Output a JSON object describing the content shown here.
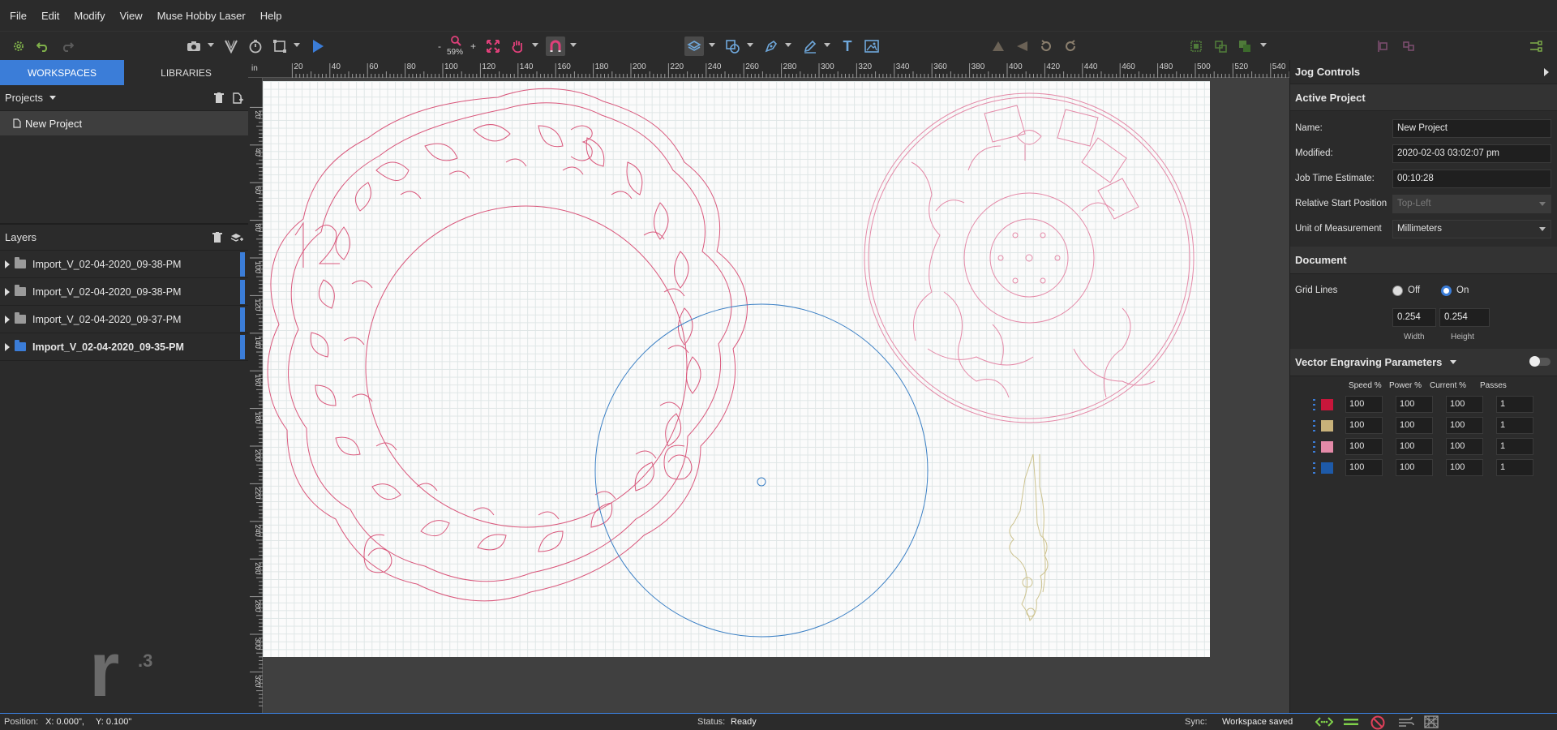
{
  "menu": [
    "File",
    "Edit",
    "Modify",
    "View",
    "Muse Hobby Laser",
    "Help"
  ],
  "toolbar": {
    "zoom_level": "59%",
    "zoom_minus": "-",
    "zoom_plus": "+",
    "text_tool": "T"
  },
  "left_tabs": {
    "workspaces": "WORKSPACES",
    "libraries": "LIBRARIES"
  },
  "projects": {
    "header": "Projects",
    "items": [
      "New Project"
    ]
  },
  "layers": {
    "header": "Layers",
    "items": [
      {
        "name": "Import_V_02-04-2020_09-38-PM",
        "folder_color": "#9a9a9a"
      },
      {
        "name": "Import_V_02-04-2020_09-38-PM",
        "folder_color": "#9a9a9a"
      },
      {
        "name": "Import_V_02-04-2020_09-37-PM",
        "folder_color": "#9a9a9a"
      },
      {
        "name": "Import_V_02-04-2020_09-35-PM",
        "folder_color": "#3b7dd8"
      }
    ]
  },
  "logo": {
    "text": "r",
    "superscript": ".3"
  },
  "ruler": {
    "unit": "in",
    "top_ticks": [
      20,
      40,
      60,
      80,
      100,
      120,
      140,
      160,
      180,
      200,
      220,
      240,
      260,
      280,
      300,
      320,
      340,
      360,
      380,
      400,
      420,
      440,
      460,
      480,
      500,
      520,
      540
    ],
    "left_ticks": [
      20,
      40,
      60,
      80,
      100,
      120,
      140,
      160,
      180,
      200,
      220,
      240,
      260,
      280,
      300,
      320
    ]
  },
  "right_panel": {
    "jog_controls": "Jog Controls",
    "active_project": "Active Project",
    "fields": {
      "name_label": "Name:",
      "name_value": "New Project",
      "modified_label": "Modified:",
      "modified_value": "2020-02-03 03:02:07 pm",
      "job_time_label": "Job Time Estimate:",
      "job_time_value": "00:10:28",
      "start_pos_label": "Relative Start Position",
      "start_pos_value": "Top-Left",
      "unit_label": "Unit of Measurement",
      "unit_value": "Millimeters"
    },
    "document": "Document",
    "grid_lines_label": "Grid Lines",
    "grid_off": "Off",
    "grid_on": "On",
    "grid_width": "0.254",
    "grid_height": "0.254",
    "width_label": "Width",
    "height_label": "Height",
    "vector_params": "Vector Engraving Parameters",
    "columns": [
      "Speed %",
      "Power %",
      "Current %",
      "Passes"
    ],
    "param_rows": [
      {
        "color": "#c8163b",
        "speed": "100",
        "power": "100",
        "current": "100",
        "passes": "1"
      },
      {
        "color": "#c8b27a",
        "speed": "100",
        "power": "100",
        "current": "100",
        "passes": "1"
      },
      {
        "color": "#e48aa8",
        "speed": "100",
        "power": "100",
        "current": "100",
        "passes": "1"
      },
      {
        "color": "#1e5aa8",
        "speed": "100",
        "power": "100",
        "current": "100",
        "passes": "1"
      }
    ]
  },
  "status": {
    "position_label": "Position:",
    "position_x": "X:  0.000\",",
    "position_y": "Y:  0.100\"",
    "status_label": "Status:",
    "status_value": "Ready",
    "sync_label": "Sync:",
    "sync_value": "Workspace saved"
  },
  "colors": {
    "accent": "#3b7dd8",
    "pink_art": "#d9587c",
    "blue_art": "#3a7fc4",
    "gold_art": "#cdc38f"
  }
}
